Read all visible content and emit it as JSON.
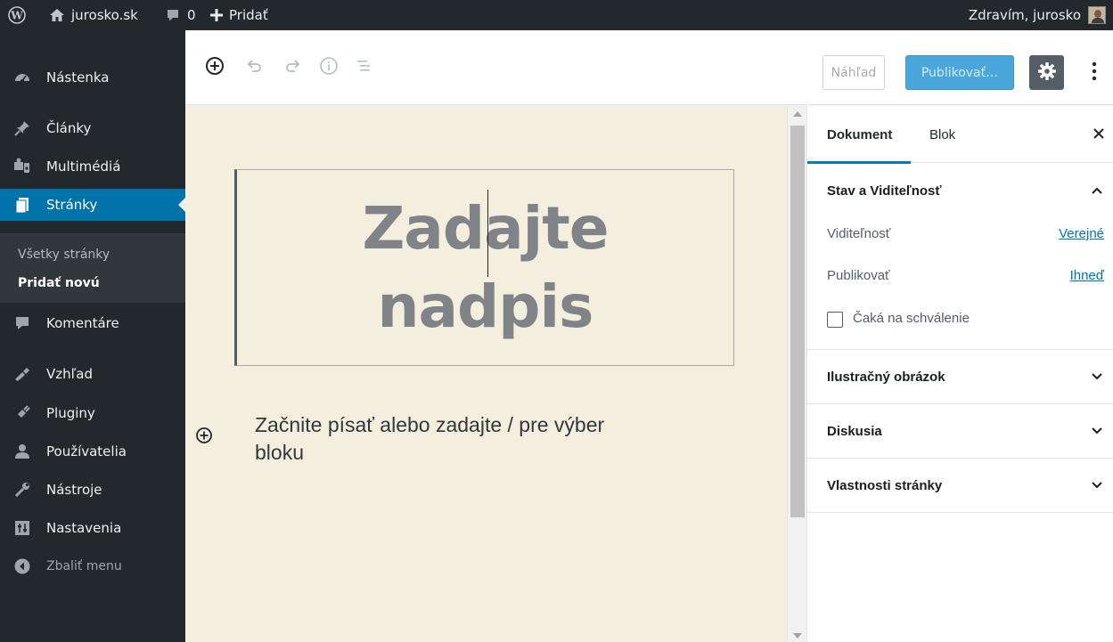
{
  "adminbar": {
    "site_name": "jurosko.sk",
    "comments_count": "0",
    "new_label": "Pridať",
    "greeting": "Zdravím, jurosko"
  },
  "sidebar": {
    "items": [
      {
        "label": "Nástenka",
        "icon": "dashboard-icon"
      },
      {
        "label": "Články",
        "icon": "pin-icon"
      },
      {
        "label": "Multimédiá",
        "icon": "media-icon"
      },
      {
        "label": "Stránky",
        "icon": "pages-icon"
      },
      {
        "label": "Komentáre",
        "icon": "comments-icon"
      },
      {
        "label": "Vzhľad",
        "icon": "appearance-icon"
      },
      {
        "label": "Pluginy",
        "icon": "plugins-icon"
      },
      {
        "label": "Používatelia",
        "icon": "users-icon"
      },
      {
        "label": "Nástroje",
        "icon": "tools-icon"
      },
      {
        "label": "Nastavenia",
        "icon": "settings-icon"
      }
    ],
    "submenu": [
      "Všetky stránky",
      "Pridať novú"
    ],
    "collapse_label": "Zbaliť menu"
  },
  "header": {
    "preview_label": "Náhľad",
    "publish_label": "Publikovať…"
  },
  "editor": {
    "title_placeholder_line1": "Zadajte",
    "title_placeholder_line2": "nadpis",
    "body_placeholder": "Začnite písať alebo zadajte / pre výber bloku"
  },
  "settings": {
    "tab_document": "Dokument",
    "tab_block": "Blok",
    "status_panel": {
      "title": "Stav a Viditeľnosť",
      "visibility_label": "Viditeľnosť",
      "visibility_value": "Verejné",
      "publish_label": "Publikovať",
      "publish_value": "Ihneď",
      "pending_label": "Čaká na schválenie"
    },
    "panels": [
      "Ilustračný obrázok",
      "Diskusia",
      "Vlastnosti stránky"
    ]
  },
  "colors": {
    "admin_dark": "#23282d",
    "admin_blue": "#0073aa",
    "canvas_bg": "#f4eedf",
    "publish_button": "#4ba7db"
  }
}
